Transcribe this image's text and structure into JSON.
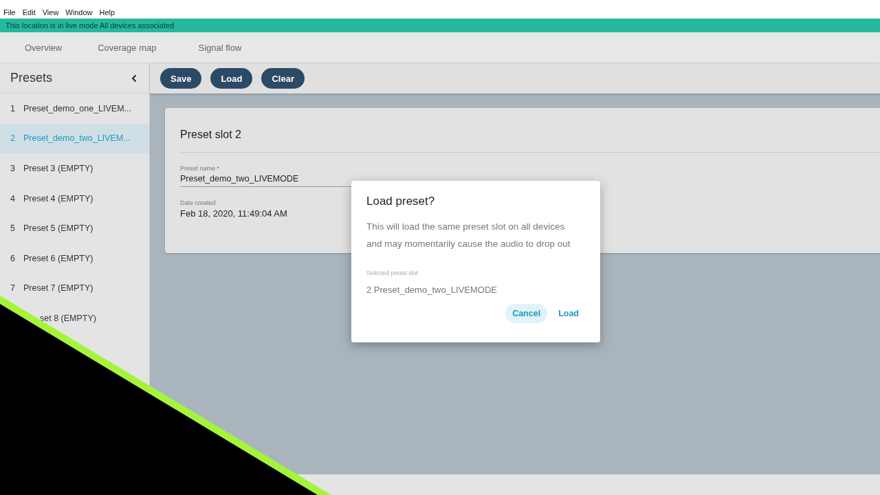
{
  "menu": [
    "File",
    "Edit",
    "View",
    "Window",
    "Help"
  ],
  "banner": "This location is in live mode All devices associated",
  "tabs": [
    {
      "label": "Overview"
    },
    {
      "label": "Coverage map"
    },
    {
      "label": "Signal flow"
    }
  ],
  "sidebar": {
    "title": "Presets",
    "items": [
      {
        "kind": "full",
        "number": "1",
        "label": "Preset_demo_one_LIVEM...",
        "selected": false
      },
      {
        "kind": "full",
        "number": "2",
        "label": "Preset_demo_two_LIVEM...",
        "selected": true
      },
      {
        "kind": "full",
        "number": "3",
        "label": "Preset 3 (EMPTY)",
        "selected": false
      },
      {
        "kind": "full",
        "number": "4",
        "label": "Preset 4 (EMPTY)",
        "selected": false
      },
      {
        "kind": "full",
        "number": "5",
        "label": "Preset 5 (EMPTY)",
        "selected": false
      },
      {
        "kind": "full",
        "number": "6",
        "label": "Preset 6 (EMPTY)",
        "selected": false
      },
      {
        "kind": "full",
        "number": "7",
        "label": "Preset 7 (EMPTY)",
        "selected": false
      },
      {
        "kind": "partial",
        "label": "set 8 (EMPTY)",
        "selected": false
      }
    ]
  },
  "toolbar": [
    "Save",
    "Load",
    "Clear"
  ],
  "card": {
    "title": "Preset slot 2",
    "fields": [
      {
        "kind": "input",
        "label": "Preset name *",
        "value": "Preset_demo_two_LIVEMODE"
      },
      {
        "kind": "text",
        "label": "Date created",
        "value": "Feb 18, 2020, 11:49:04 AM"
      }
    ]
  },
  "dialog": {
    "title": "Load preset?",
    "message": "This will load the same preset slot on all devices and may momentarily cause the audio to drop out",
    "field_label": "Selected preset slot",
    "field_value": "2 Preset_demo_two_LIVEMODE",
    "buttons": [
      {
        "label": "Cancel",
        "focused": true
      },
      {
        "label": "Load",
        "focused": false
      }
    ]
  }
}
